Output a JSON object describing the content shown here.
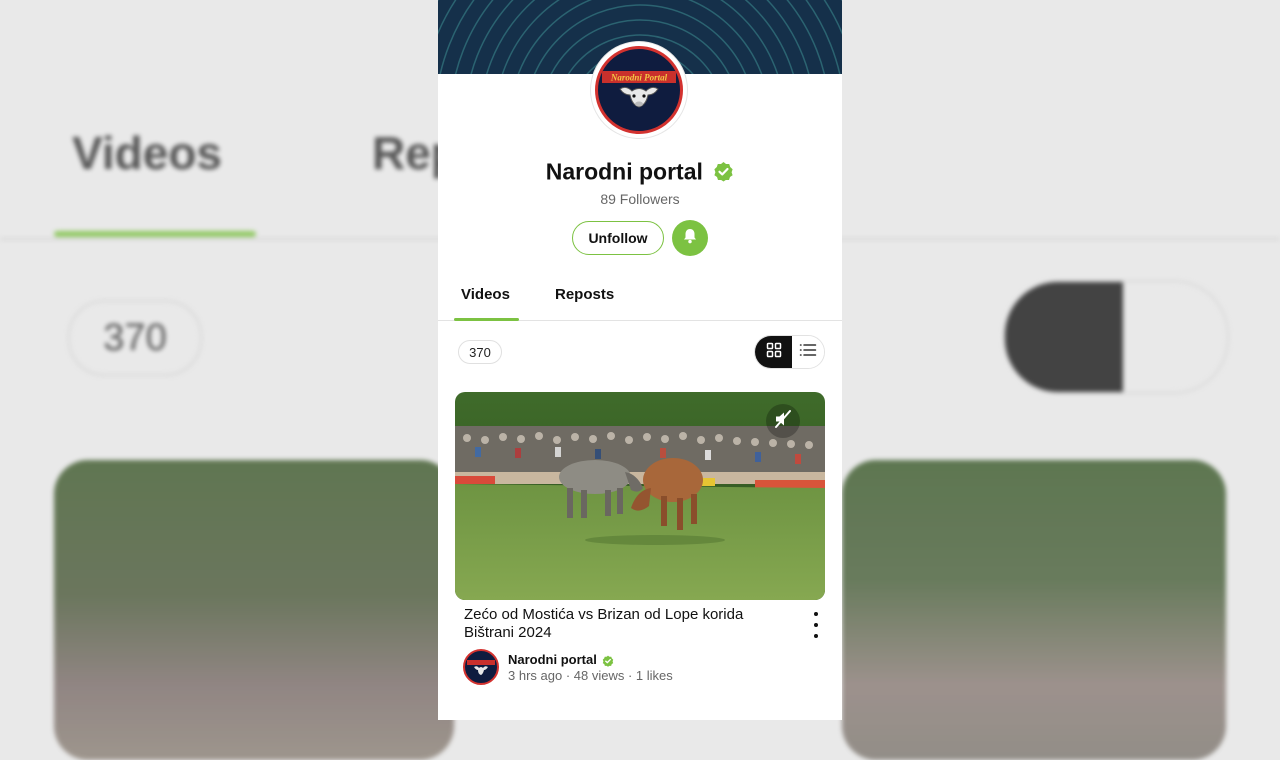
{
  "background": {
    "tab_videos": "Videos",
    "tab_reposts": "Rep",
    "video_count": "370"
  },
  "channel": {
    "name": "Narodni portal",
    "logo_text": "Narodni Portal",
    "followers": "89 Followers",
    "verified": true,
    "unfollow_label": "Unfollow"
  },
  "tabs": [
    {
      "label": "Videos",
      "active": true
    },
    {
      "label": "Reposts",
      "active": false
    }
  ],
  "video_count": "370",
  "view_mode": "grid",
  "video": {
    "title": "Zećo od Mostića vs Brizan od Lope korida Bištrani 2024",
    "channel": "Narodni portal",
    "stats": "3 hrs ago · 48 views · 1 likes",
    "muted": true
  },
  "colors": {
    "accent": "#7cc242",
    "banner": "#15304a",
    "logo_ring": "#d3322f",
    "logo_bg": "#0f1c3f"
  }
}
